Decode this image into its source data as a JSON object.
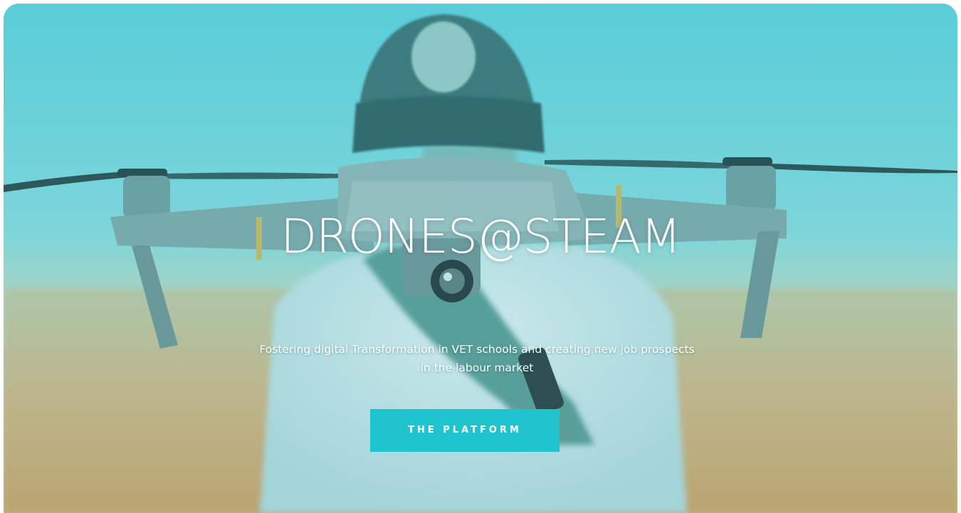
{
  "hero": {
    "title": "DRONES@STEAM",
    "subtitle_line1": "Fostering digital Transformation in VET schools and creating new job prospects",
    "subtitle_line2": "in the labour market",
    "cta_label": "THE PLATFORM",
    "background_image": "person holding a drone over a wheat field"
  },
  "colors": {
    "accent": "#1fc4cf",
    "overlay": "#6fd3dc",
    "text": "#ffffff"
  }
}
